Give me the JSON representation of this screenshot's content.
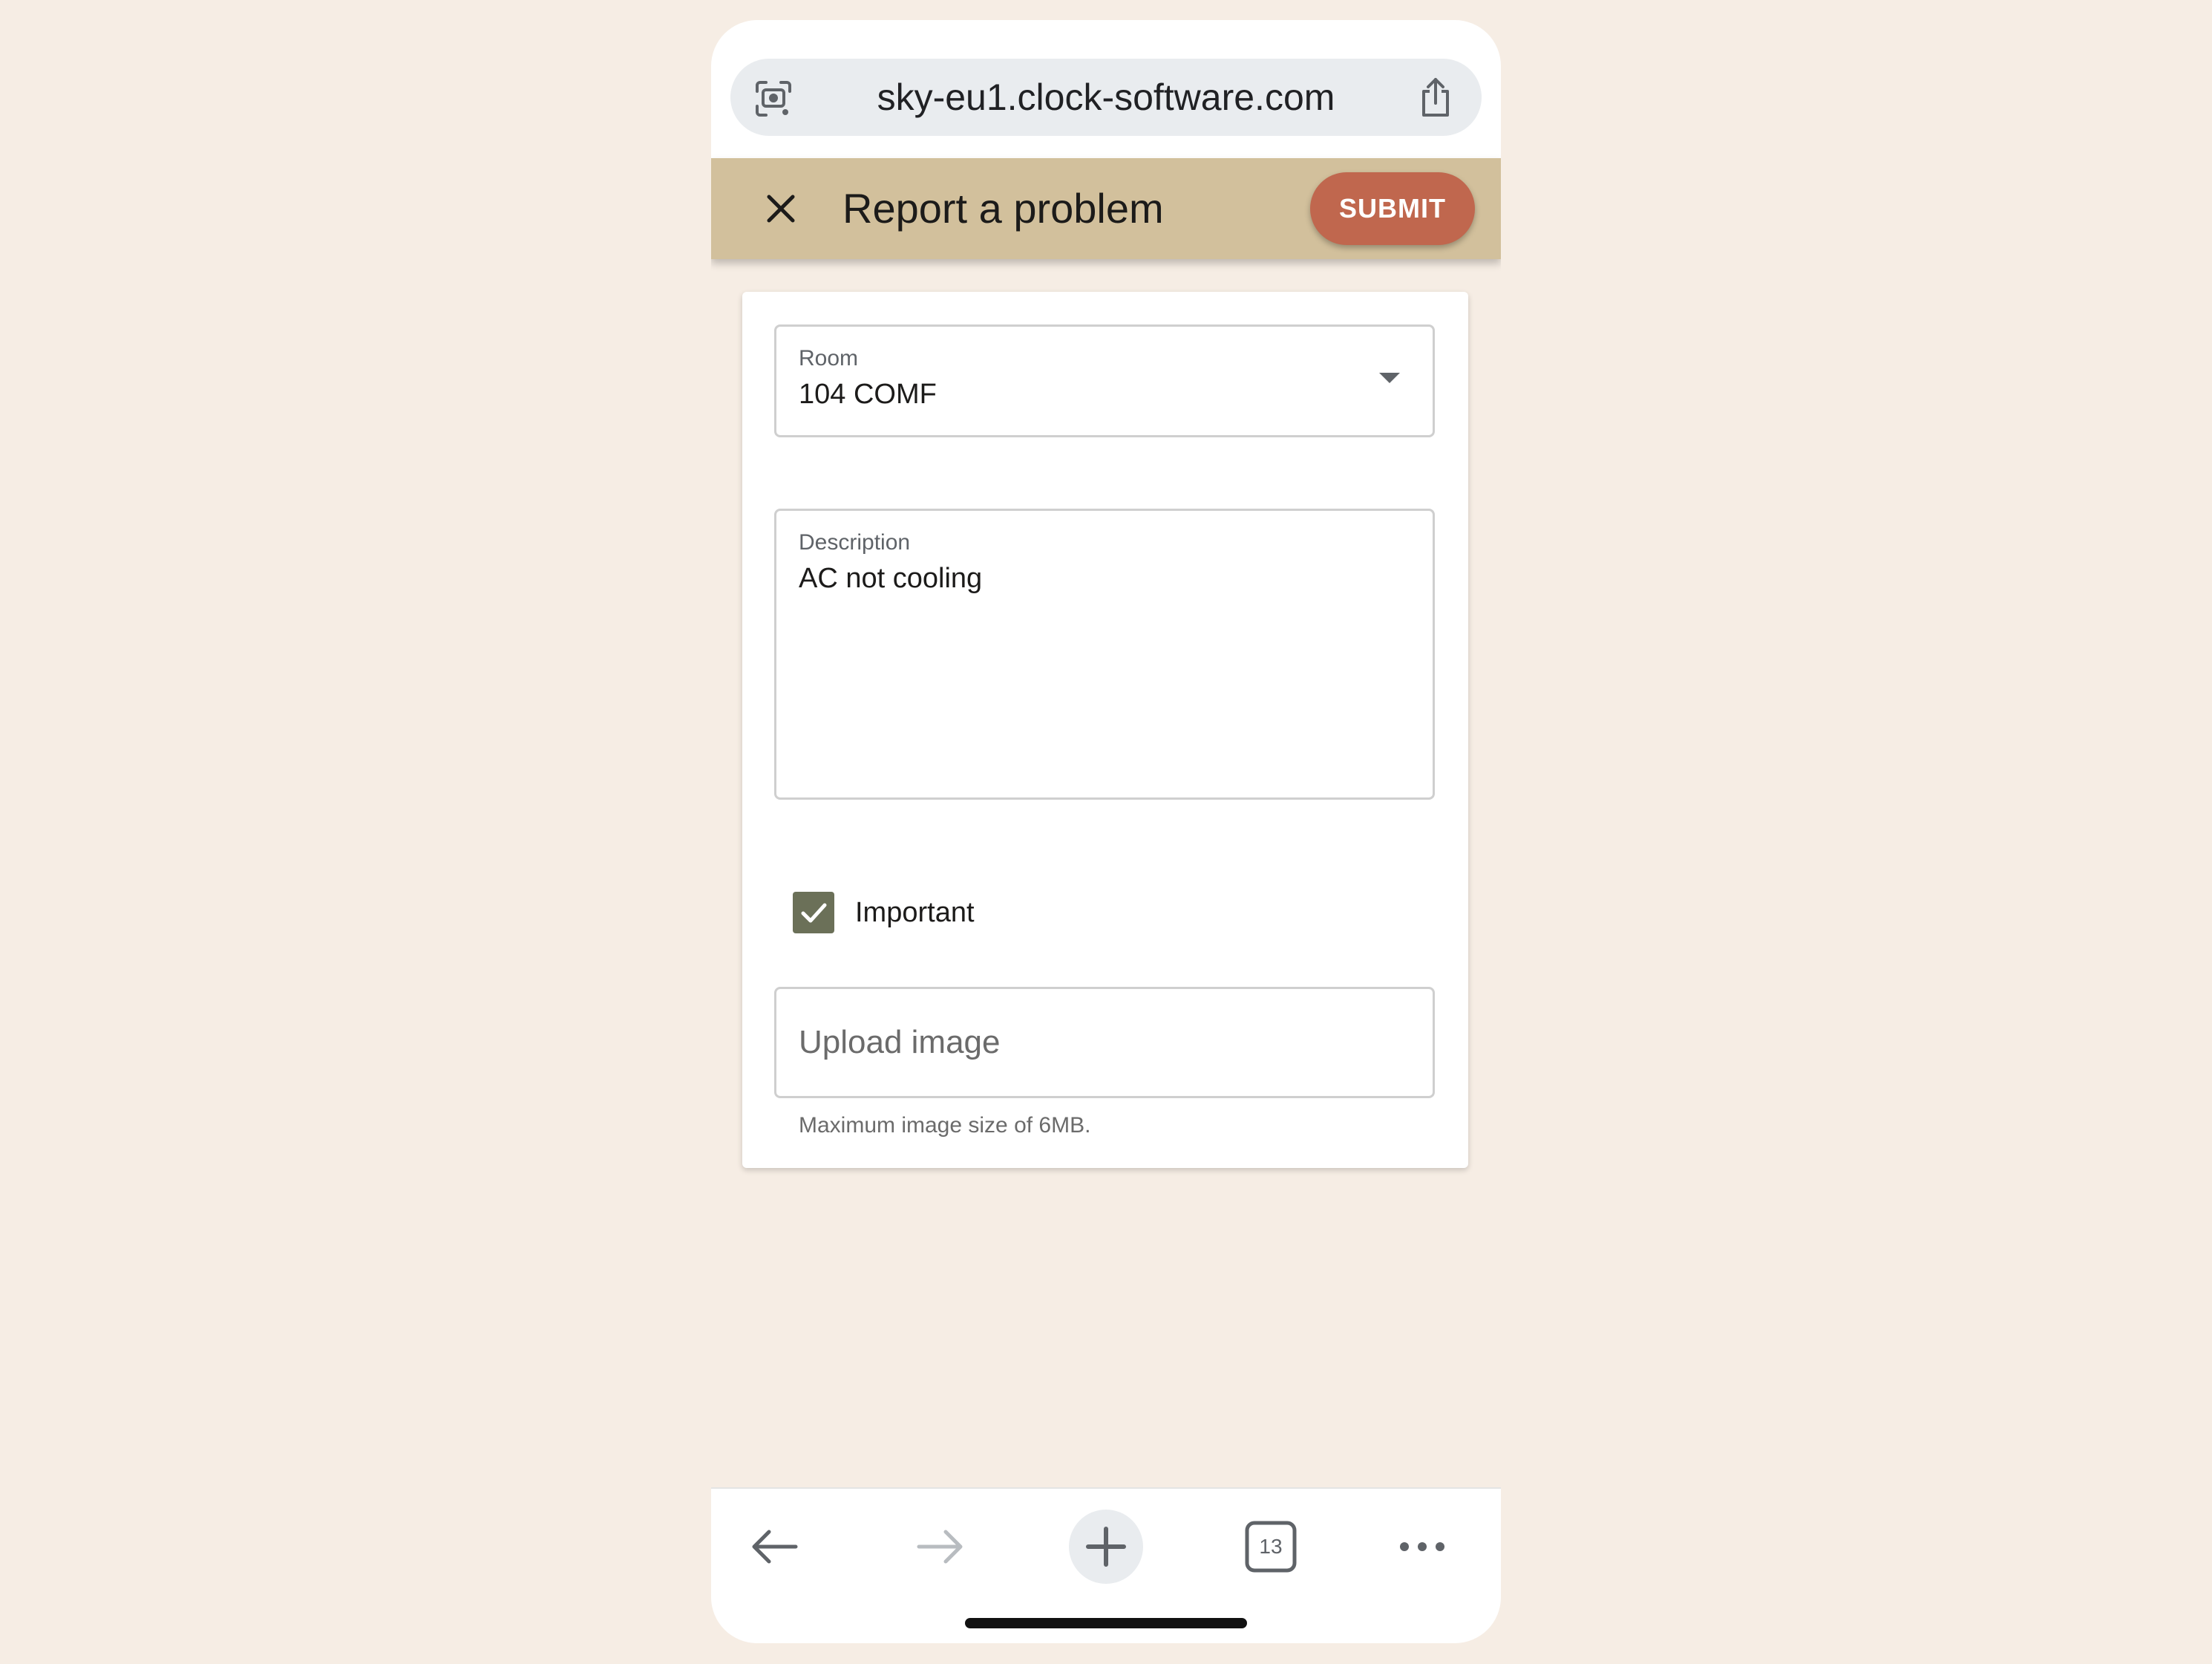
{
  "browser": {
    "url": "sky-eu1.clock-software.com",
    "icons": {
      "lens": "lens-camera-icon",
      "share": "share-icon"
    },
    "tab_count": "13"
  },
  "app_bar": {
    "title": "Report a problem",
    "submit_label": "SUBMIT",
    "color": "#d2c09c",
    "submit_color": "#c0674e"
  },
  "form": {
    "room": {
      "label": "Room",
      "value": "104 COMF"
    },
    "description": {
      "label": "Description",
      "value": "AC not cooling"
    },
    "important": {
      "label": "Important",
      "checked": true,
      "color": "#6b7058"
    },
    "upload": {
      "placeholder": "Upload image",
      "hint": "Maximum image size of 6MB."
    }
  },
  "bottom_nav": {
    "icons": [
      "back-arrow-icon",
      "forward-arrow-icon",
      "plus-icon",
      "tabs-icon",
      "more-icon"
    ]
  }
}
